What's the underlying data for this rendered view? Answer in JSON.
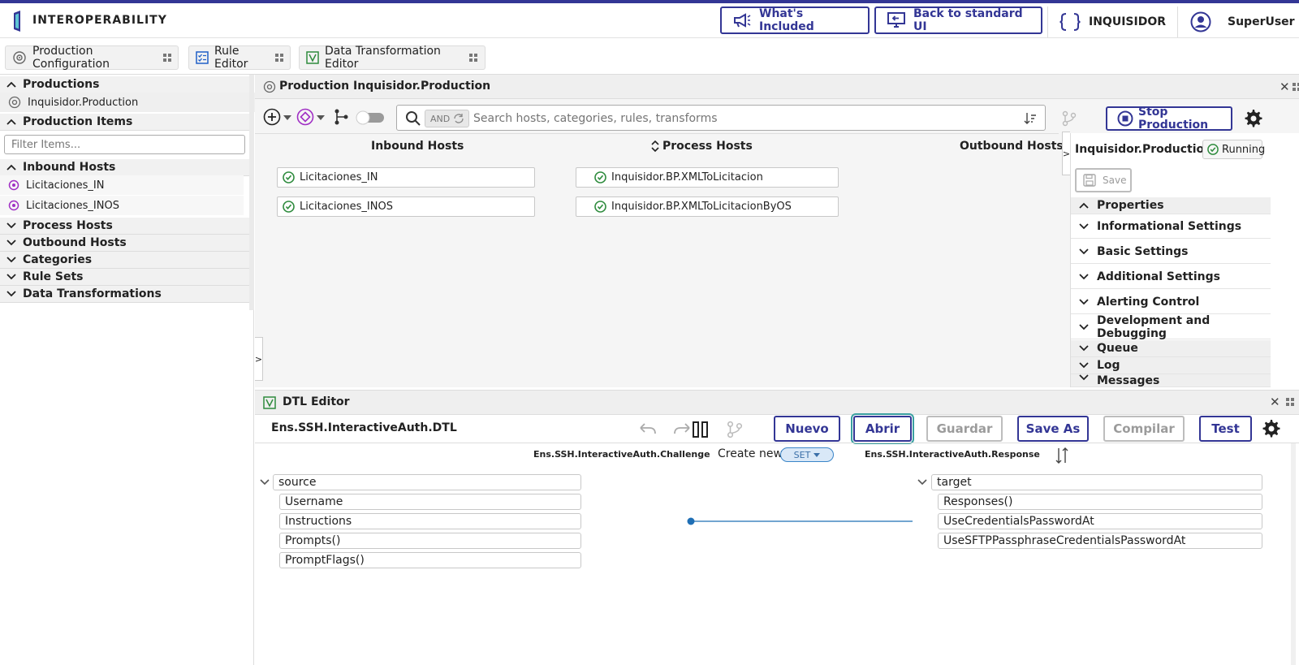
{
  "header": {
    "brand": "INTEROPERABILITY",
    "whats_included": "What's Included",
    "back_to_standard": "Back to standard UI",
    "namespace": "INQUISIDOR",
    "user": "SuperUser"
  },
  "tabs": [
    {
      "label": "Production Configuration"
    },
    {
      "label": "Rule Editor"
    },
    {
      "label": "Data Transformation Editor"
    }
  ],
  "left": {
    "productions_title": "Productions",
    "production_item": "Inquisidor.Production",
    "production_items_title": "Production Items",
    "filter_placeholder": "Filter Items...",
    "inbound_title": "Inbound Hosts",
    "inbound_items": [
      "Licitaciones_IN",
      "Licitaciones_INOS"
    ],
    "process_title": "Process Hosts",
    "outbound_title": "Outbound Hosts",
    "categories_title": "Categories",
    "rulesets_title": "Rule Sets",
    "dt_title": "Data Transformations"
  },
  "production": {
    "title": "Production Inquisidor.Production",
    "and_label": "AND",
    "search_placeholder": "Search hosts, categories, rules, transforms",
    "stop_label": "Stop Production",
    "col_inbound": "Inbound Hosts",
    "col_process": "Process Hosts",
    "col_outbound": "Outbound Hosts",
    "inbound_hosts": [
      "Licitaciones_IN",
      "Licitaciones_INOS"
    ],
    "process_hosts": [
      "Inquisidor.BP.XMLToLicitacion",
      "Inquisidor.BP.XMLToLicitacionByOS"
    ],
    "expand_marker": ">"
  },
  "settings": {
    "name": "Inquisidor.Production",
    "status": "Running",
    "save": "Save",
    "properties": "Properties",
    "sections": [
      "Informational Settings",
      "Basic Settings",
      "Additional Settings",
      "Alerting Control",
      "Development and Debugging"
    ],
    "queue": "Queue",
    "log": "Log",
    "messages": "Messages"
  },
  "dtl": {
    "title": "DTL Editor",
    "name": "Ens.SSH.InteractiveAuth.DTL",
    "btn_nuevo": "Nuevo",
    "btn_abrir": "Abrir",
    "btn_guardar": "Guardar",
    "btn_saveas": "Save As",
    "btn_compilar": "Compilar",
    "btn_test": "Test",
    "source_class": "Ens.SSH.InteractiveAuth.Challenge",
    "create_new": "Create new",
    "set_label": "SET",
    "target_class": "Ens.SSH.InteractiveAuth.Response",
    "source_root": "source",
    "source_fields": [
      "Username",
      "Instructions",
      "Prompts()",
      "PromptFlags()"
    ],
    "target_root": "target",
    "target_fields": [
      "Responses()",
      "UseCredentialsPasswordAt",
      "UseSFTPPassphraseCredentialsPasswordAt"
    ]
  },
  "colors": {
    "brand": "#333695",
    "running": "#2e8b3d",
    "link": "#1f6fb5",
    "purple": "#a02fc4"
  }
}
